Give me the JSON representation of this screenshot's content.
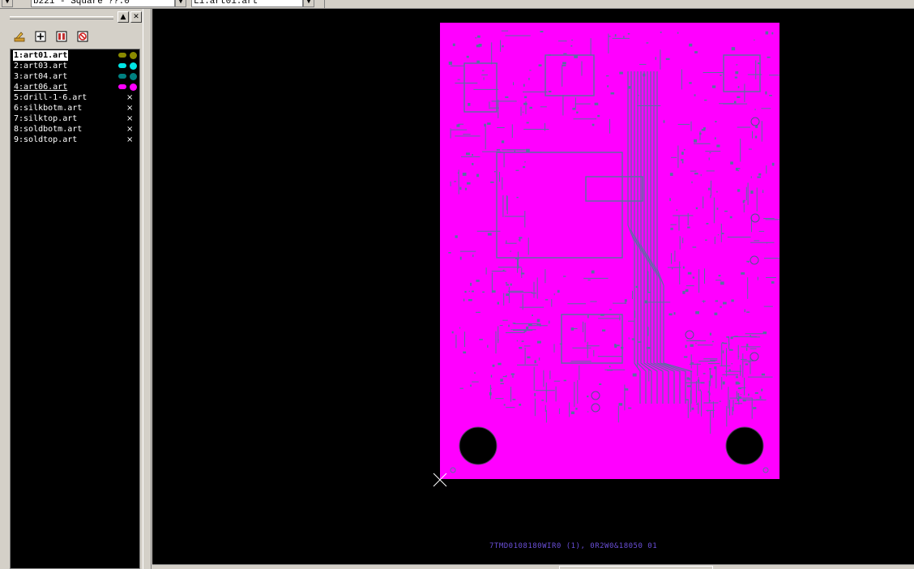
{
  "toolbar": {
    "combo_left": "b221 - Square ??.0",
    "combo_right": "L1:art01.art",
    "dropdown_arrow": "▼"
  },
  "panel": {
    "minimize_glyph": "▲",
    "close_glyph": "✕",
    "tools": [
      {
        "name": "pencil-icon"
      },
      {
        "name": "add-layer-icon"
      },
      {
        "name": "book-icon"
      },
      {
        "name": "delete-layer-icon"
      }
    ]
  },
  "layers": [
    {
      "label": "1:art01.art",
      "color": "#8a8a00",
      "visible": true,
      "selected": true
    },
    {
      "label": "2:art03.art",
      "color": "#00e5e5",
      "visible": true
    },
    {
      "label": "3:art04.art",
      "color": "#008080",
      "visible": true
    },
    {
      "label": "4:art06.art",
      "color": "#ff00ff",
      "visible": true,
      "underline": true
    },
    {
      "label": "5:drill-1-6.art",
      "visible": false
    },
    {
      "label": "6:silkbotm.art",
      "visible": false
    },
    {
      "label": "7:silktop.art",
      "visible": false
    },
    {
      "label": "8:soldbotm.art",
      "visible": false
    },
    {
      "label": "9:soldtop.art",
      "visible": false
    }
  ],
  "hidden_marker": "×",
  "canvas": {
    "board_color": "#ff00ff",
    "trace_color": "#5a6fa0",
    "bottom_text": "7TMD0108180WIR0 (1), 0R2W0&18050 01"
  }
}
